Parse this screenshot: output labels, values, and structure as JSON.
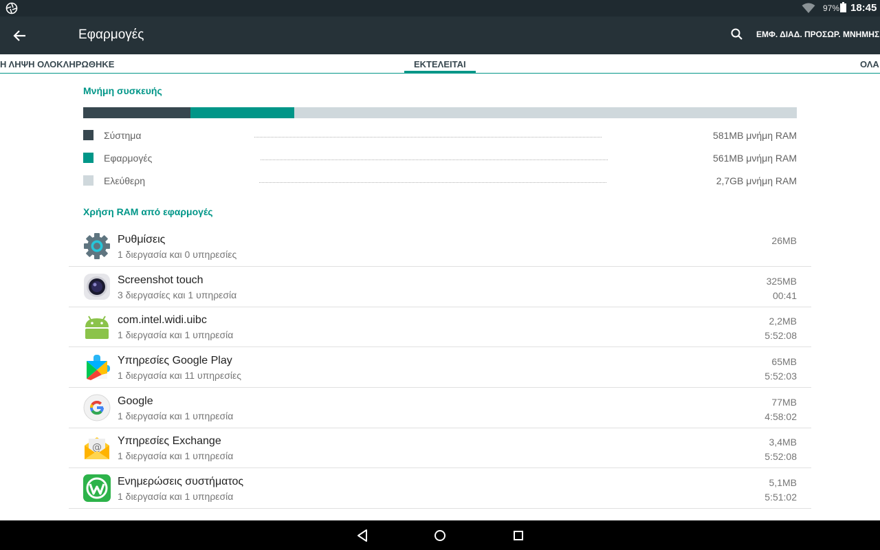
{
  "status_bar": {
    "battery_percent": "97%",
    "time": "18:45"
  },
  "app_bar": {
    "title": "Εφαρμογές",
    "action_label": "ΕΜΦ. ΔΙΑΔ. ΠΡΟΣΩΡ. ΜΝΗΜΗΣ"
  },
  "tabs": [
    {
      "label": "Η ΛΗΨΗ ΟΛΟΚΛΗΡΩΘΗΚΕ",
      "selected": false
    },
    {
      "label": "ΕΚΤΕΛΕΙΤΑΙ",
      "selected": true
    },
    {
      "label": "ΟΛΑ",
      "selected": false
    }
  ],
  "memory": {
    "header": "Μνήμη συσκευής",
    "bar_fractions": {
      "system": 0.15,
      "apps": 0.145,
      "free": 0.705
    },
    "legend": [
      {
        "label": "Σύστημα",
        "value": "581MB μνήμη RAM",
        "color": "#37474f"
      },
      {
        "label": "Εφαρμογές",
        "value": "561MB μνήμη RAM",
        "color": "#009688"
      },
      {
        "label": "Ελεύθερη",
        "value": "2,7GB μνήμη RAM",
        "color": "#cfd8dc"
      }
    ]
  },
  "apps_section": {
    "header": "Χρήση RAM από εφαρμογές",
    "items": [
      {
        "name": "Ρυθμίσεις",
        "sub": "1 διεργασία και 0 υπηρεσίες",
        "size": "26MB",
        "time": "",
        "icon": "settings-icon"
      },
      {
        "name": "Screenshot touch",
        "sub": "3 διεργασίες και 1 υπηρεσία",
        "size": "325MB",
        "time": "00:41",
        "icon": "screenshot-touch-icon"
      },
      {
        "name": "com.intel.widi.uibc",
        "sub": "1 διεργασία και 1 υπηρεσία",
        "size": "2,2MB",
        "time": "5:52:08",
        "icon": "android-icon"
      },
      {
        "name": "Υπηρεσίες Google Play",
        "sub": "1 διεργασία και 11 υπηρεσίες",
        "size": "65MB",
        "time": "5:52:03",
        "icon": "google-play-services-icon"
      },
      {
        "name": "Google",
        "sub": "1 διεργασία και 1 υπηρεσία",
        "size": "77MB",
        "time": "4:58:02",
        "icon": "google-icon"
      },
      {
        "name": "Υπηρεσίες Exchange",
        "sub": "1 διεργασία και 1 υπηρεσία",
        "size": "3,4MB",
        "time": "5:52:08",
        "icon": "exchange-mail-icon"
      },
      {
        "name": "Ενημερώσεις συστήματος",
        "sub": "1 διεργασία και 1 υπηρεσία",
        "size": "5,1MB",
        "time": "5:51:02",
        "icon": "system-update-icon"
      }
    ]
  },
  "nav_bar": {
    "icons": [
      "back-triangle-icon",
      "home-circle-icon",
      "recents-square-icon"
    ]
  }
}
